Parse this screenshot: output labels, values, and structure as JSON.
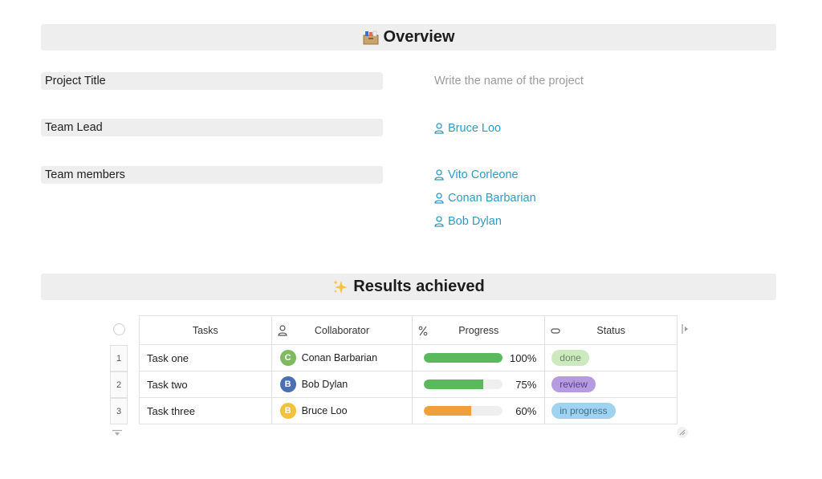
{
  "overview": {
    "emoji": "🗃️",
    "title": "Overview"
  },
  "fields": {
    "project_title": {
      "label": "Project Title",
      "placeholder": "Write the name of the project"
    },
    "team_lead": {
      "label": "Team Lead",
      "value": "Bruce Loo"
    },
    "team_members": {
      "label": "Team members",
      "members": [
        "Vito Corleone",
        "Conan Barbarian",
        "Bob Dylan"
      ]
    }
  },
  "results": {
    "emoji": "✨",
    "title": "Results achieved"
  },
  "table": {
    "columns": [
      "Tasks",
      "Collaborator",
      "Progress",
      "Status"
    ],
    "rows": [
      {
        "num": "1",
        "task": "Task one",
        "initial": "C",
        "collaborator": "Conan Barbarian",
        "avatar_color": "#7dbb5e",
        "progress": 1.0,
        "progress_label": "100%",
        "bar_color": "#5cb85c",
        "status": "done",
        "status_bg": "#cde9c0",
        "status_fg": "#6a8a5a"
      },
      {
        "num": "2",
        "task": "Task two",
        "initial": "B",
        "collaborator": "Bob Dylan",
        "avatar_color": "#4a6fb5",
        "progress": 0.75,
        "progress_label": "75%",
        "bar_color": "#5cb85c",
        "status": "review",
        "status_bg": "#b69be0",
        "status_fg": "#5a3f8a"
      },
      {
        "num": "3",
        "task": "Task three",
        "initial": "B",
        "collaborator": "Bruce Loo",
        "avatar_color": "#f2c33a",
        "progress": 0.6,
        "progress_label": "60%",
        "bar_color": "#f0a03a",
        "status": "in progress",
        "status_bg": "#9fd3f0",
        "status_fg": "#3f6f8a"
      }
    ]
  }
}
